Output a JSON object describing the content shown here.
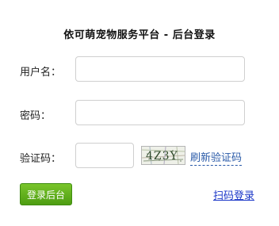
{
  "page": {
    "title": "依可萌宠物服务平台 - 后台登录"
  },
  "form": {
    "username_label": "用户名：",
    "username_value": "",
    "password_label": "密码：",
    "password_value": "",
    "code_label": "验证码：",
    "code_value": "",
    "captcha_text": "4Z3Y",
    "refresh_label": "刷新验证码"
  },
  "actions": {
    "login_label": "登录后台",
    "scan_label": "扫码登录"
  },
  "colors": {
    "button_green": "#5aab18",
    "link_blue": "#1a36c8",
    "refresh_blue": "#2a5aa8"
  }
}
